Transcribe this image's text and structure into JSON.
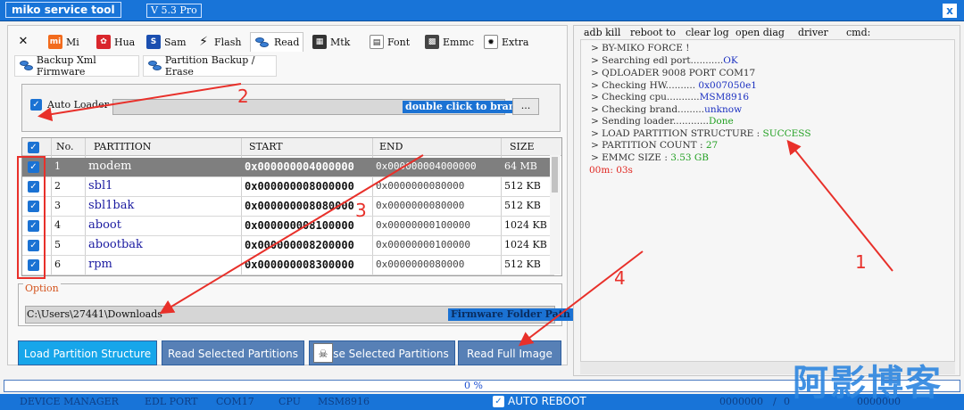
{
  "titlebar": {
    "title": "miko service tool",
    "version": "V 5.3 Pro",
    "close_label": "x"
  },
  "tabs": [
    {
      "label": "",
      "icon": "tools-icon"
    },
    {
      "label": "Mi",
      "icon": "xiaomi-icon"
    },
    {
      "label": "Hua",
      "icon": "huawei-icon"
    },
    {
      "label": "Sam",
      "icon": "samsung-icon"
    },
    {
      "label": "Flash",
      "icon": "flash-icon"
    },
    {
      "label": "Read",
      "icon": "database-icon"
    },
    {
      "label": "Mtk",
      "icon": "chip-icon"
    },
    {
      "label": "Font",
      "icon": "font-icon"
    },
    {
      "label": "Emmc",
      "icon": "emmc-chip-icon"
    },
    {
      "label": "Extra",
      "icon": "extra-icon"
    }
  ],
  "subtabs": [
    "Backup Xml Firmware",
    "Partition Backup / Erase"
  ],
  "loader": {
    "checkbox_label": "Auto Loader",
    "brand_button": "double click to brand",
    "dots_button": "..."
  },
  "table": {
    "headers": [
      "No.",
      "PARTITION",
      "START",
      "END",
      "SIZE"
    ],
    "rows": [
      {
        "no": "1",
        "partition": "modem",
        "start": "0x000000004000000",
        "end": "0x000000004000000",
        "size": "64 MB"
      },
      {
        "no": "2",
        "partition": "sbl1",
        "start": "0x000000008000000",
        "end": "0x0000000080000",
        "size": "512 KB"
      },
      {
        "no": "3",
        "partition": "sbl1bak",
        "start": "0x000000008080000",
        "end": "0x0000000080000",
        "size": "512 KB"
      },
      {
        "no": "4",
        "partition": "aboot",
        "start": "0x000000008100000",
        "end": "0x00000000100000",
        "size": "1024 KB"
      },
      {
        "no": "5",
        "partition": "abootbak",
        "start": "0x000000008200000",
        "end": "0x00000000100000",
        "size": "1024 KB"
      },
      {
        "no": "6",
        "partition": "rpm",
        "start": "0x000000008300000",
        "end": "0x0000000080000",
        "size": "512 KB"
      }
    ]
  },
  "option": {
    "label": "Option",
    "path": "C:\\Users\\27441\\Downloads",
    "folder_button": "Firmware Folder Path"
  },
  "actions": {
    "load": "Load Partition Structure",
    "read_selected": "Read Selected Partitions",
    "erase_selected": "se Selected Partitions",
    "read_full": "Read Full Image"
  },
  "menu": [
    "adb kill",
    "reboot to",
    "clear log",
    "open diag",
    "driver",
    "cmd:"
  ],
  "log": [
    {
      "text": "> BY-MIKO FORCE !",
      "value": ""
    },
    {
      "text": "> Searching edl port...........",
      "value": "OK"
    },
    {
      "text": "> QDLOADER 9008 PORT COM17",
      "value": ""
    },
    {
      "text": "> Checking HW.......... ",
      "value": "0x007050e1"
    },
    {
      "text": "> Checking cpu...........",
      "value": "MSM8916"
    },
    {
      "text": "> Checking brand.........",
      "value": "unknow"
    },
    {
      "text": "> Sending loader............",
      "value": "Done"
    },
    {
      "text": "> LOAD PARTITION  STRUCTURE  :  ",
      "value": "SUCCESS"
    },
    {
      "text": "> PARTITION COUNT  :  ",
      "value": "27"
    },
    {
      "text": "> EMMC SIZE   :  ",
      "value": "3.53 GB"
    },
    {
      "text": "",
      "value": "00m: 03s"
    }
  ],
  "progress": {
    "text": "0   %",
    "percent": 0
  },
  "statusbar": {
    "device_manager": "DEVICE MANAGER",
    "edl_port_label": "EDL PORT",
    "edl_port_value": "COM17",
    "cpu_label": "CPU",
    "cpu_value": "MSM8916",
    "auto_reboot": "AUTO REBOOT",
    "counter_a": "0000000",
    "counter_sep": "/",
    "counter_b": "0",
    "counter_c": "0000000"
  },
  "annotations": [
    "1",
    "2",
    "3",
    "4"
  ],
  "watermark": "阿影博客",
  "colors": {
    "accent": "#1874d8",
    "annotation": "#e8302a",
    "success": "#22a022",
    "value": "#1a2fc0",
    "timer": "#e0231d"
  }
}
